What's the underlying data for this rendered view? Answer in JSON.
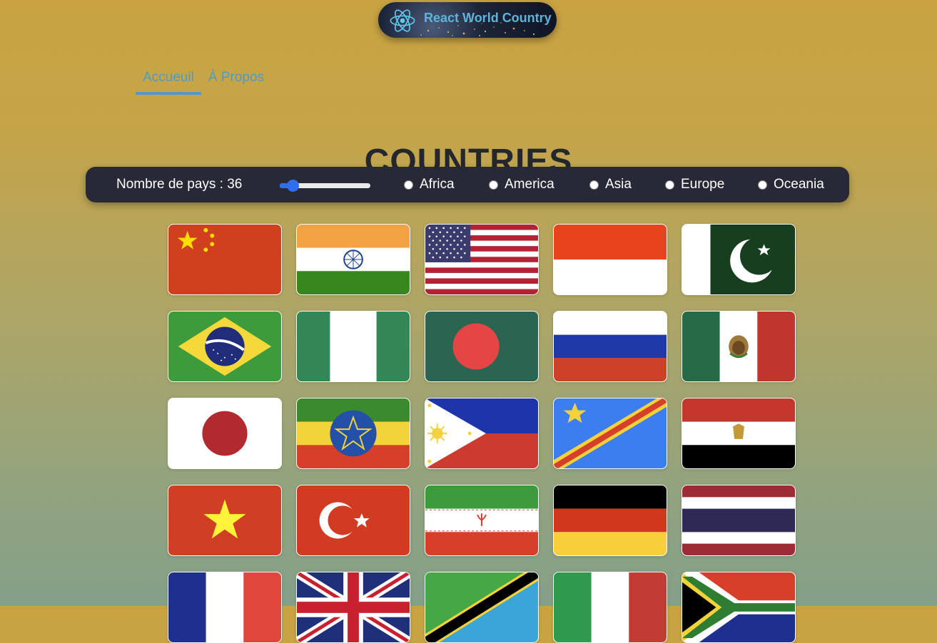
{
  "header": {
    "title": "React World Country",
    "logo_icon": "react-icon"
  },
  "nav": {
    "tabs": [
      {
        "label": "Accueuil",
        "active": true
      },
      {
        "label": "À Propos",
        "active": false
      }
    ]
  },
  "page": {
    "heading": "COUNTRIES"
  },
  "filter": {
    "count_label": "Nombre de pays : 36",
    "slider_value": 36,
    "slider_min": 1,
    "slider_max": 250,
    "regions": [
      "Africa",
      "America",
      "Asia",
      "Europe",
      "Oceania"
    ]
  },
  "countries": [
    {
      "flag": "china-flag"
    },
    {
      "flag": "india-flag"
    },
    {
      "flag": "usa-flag"
    },
    {
      "flag": "indonesia-flag"
    },
    {
      "flag": "pakistan-flag"
    },
    {
      "flag": "brazil-flag"
    },
    {
      "flag": "nigeria-flag"
    },
    {
      "flag": "bangladesh-flag"
    },
    {
      "flag": "russia-flag"
    },
    {
      "flag": "mexico-flag"
    },
    {
      "flag": "japan-flag"
    },
    {
      "flag": "ethiopia-flag"
    },
    {
      "flag": "philippines-flag"
    },
    {
      "flag": "dr-congo-flag"
    },
    {
      "flag": "egypt-flag"
    },
    {
      "flag": "vietnam-flag"
    },
    {
      "flag": "turkey-flag"
    },
    {
      "flag": "iran-flag"
    },
    {
      "flag": "germany-flag"
    },
    {
      "flag": "thailand-flag"
    },
    {
      "flag": "france-flag"
    },
    {
      "flag": "uk-flag"
    },
    {
      "flag": "tanzania-flag"
    },
    {
      "flag": "italy-flag"
    },
    {
      "flag": "south-africa-flag"
    }
  ]
}
